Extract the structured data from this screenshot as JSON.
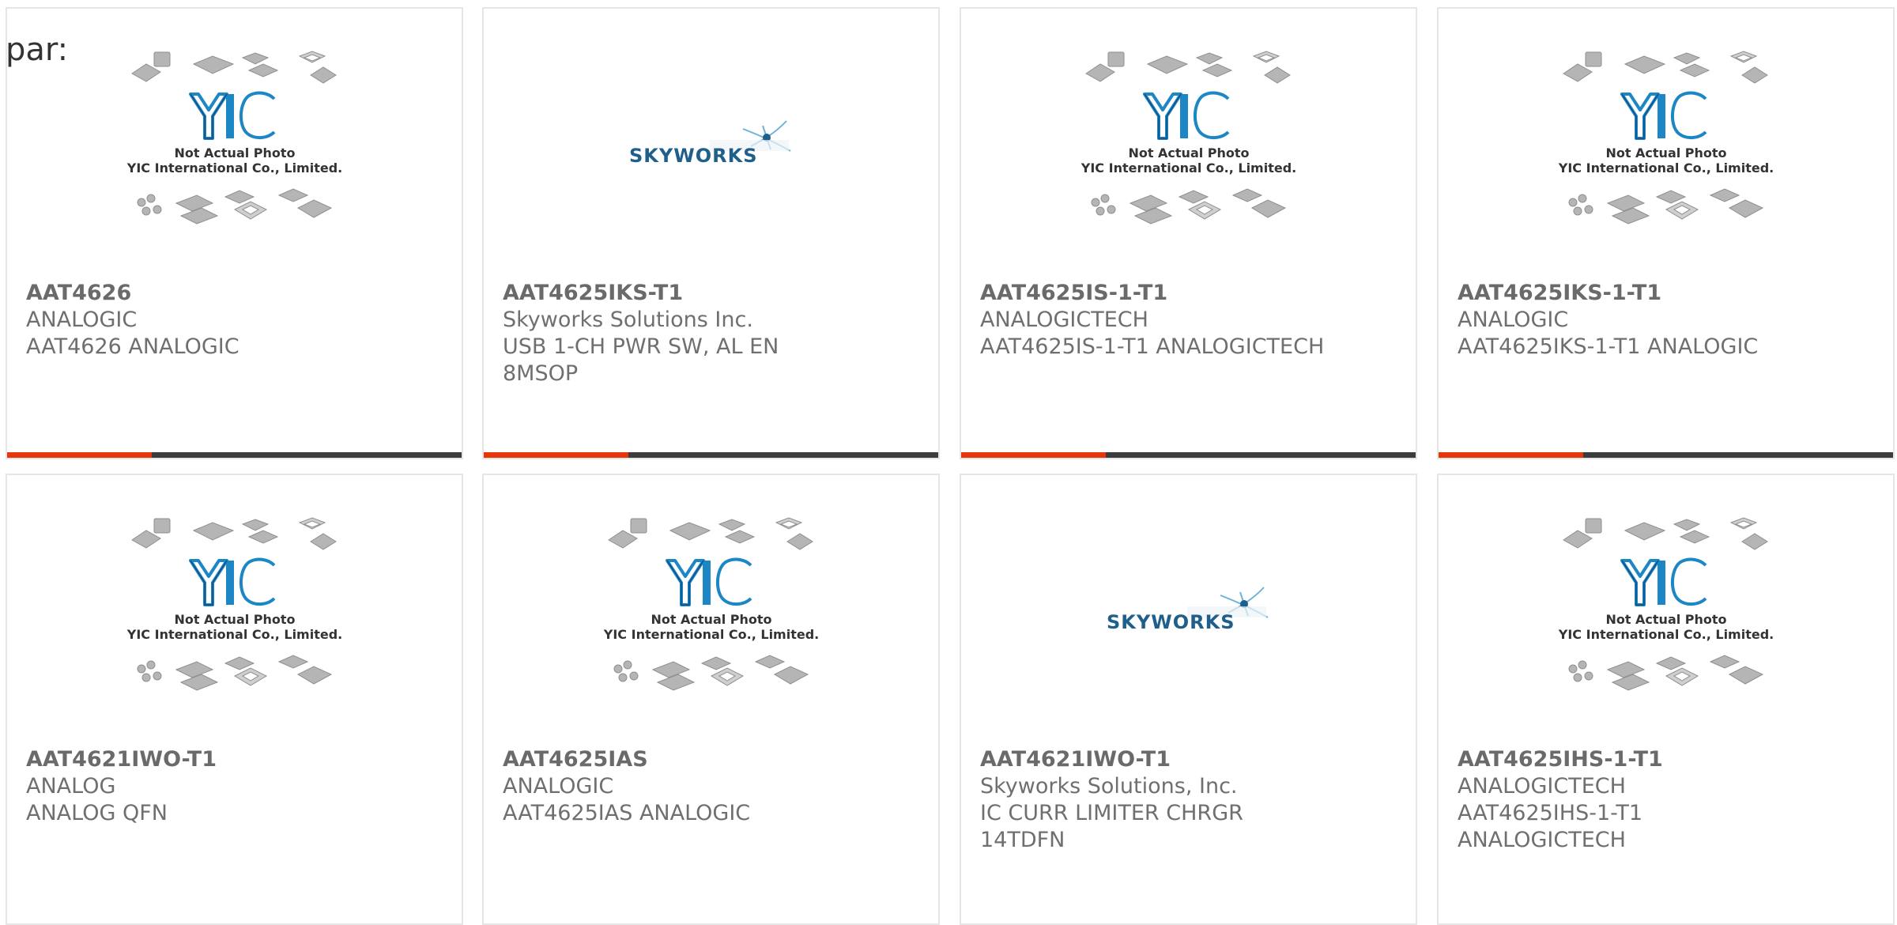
{
  "heading": "par:",
  "placeholder_texts": {
    "line1": "Not Actual Photo",
    "line2": "YIC International Co., Limited."
  },
  "logos": {
    "yic": "YIC",
    "skyworks": "SKYWORKS"
  },
  "colors": {
    "accent": "#e8360b",
    "bar": "#3c3c3c",
    "yic_blue": "#1d87c5",
    "skyworks_blue": "#1f5f8b"
  },
  "products": [
    {
      "part": "AAT4626",
      "mfr": "ANALOGIC",
      "desc": "AAT4626 ANALOGIC",
      "image": "yic-placeholder"
    },
    {
      "part": "AAT4625IKS-T1",
      "mfr": "Skyworks Solutions Inc.",
      "desc": "USB 1-CH PWR SW, AL EN\n8MSOP",
      "image": "skyworks-logo"
    },
    {
      "part": "AAT4625IS-1-T1",
      "mfr": "ANALOGICTECH",
      "desc": "AAT4625IS-1-T1 ANALOGICTECH",
      "image": "yic-placeholder"
    },
    {
      "part": "AAT4625IKS-1-T1",
      "mfr": "ANALOGIC",
      "desc": "AAT4625IKS-1-T1 ANALOGIC",
      "image": "yic-placeholder"
    },
    {
      "part": "AAT4621IWO-T1",
      "mfr": "ANALOG",
      "desc": "ANALOG QFN",
      "image": "yic-placeholder"
    },
    {
      "part": "AAT4625IAS",
      "mfr": "ANALOGIC",
      "desc": "AAT4625IAS ANALOGIC",
      "image": "yic-placeholder"
    },
    {
      "part": "AAT4621IWO-T1",
      "mfr": "Skyworks Solutions, Inc.",
      "desc": "IC CURR LIMITER CHRGR\n14TDFN",
      "image": "skyworks-logo"
    },
    {
      "part": "AAT4625IHS-1-T1",
      "mfr": "ANALOGICTECH",
      "desc": "AAT4625IHS-1-T1\nANALOGICTECH",
      "image": "yic-placeholder"
    }
  ]
}
